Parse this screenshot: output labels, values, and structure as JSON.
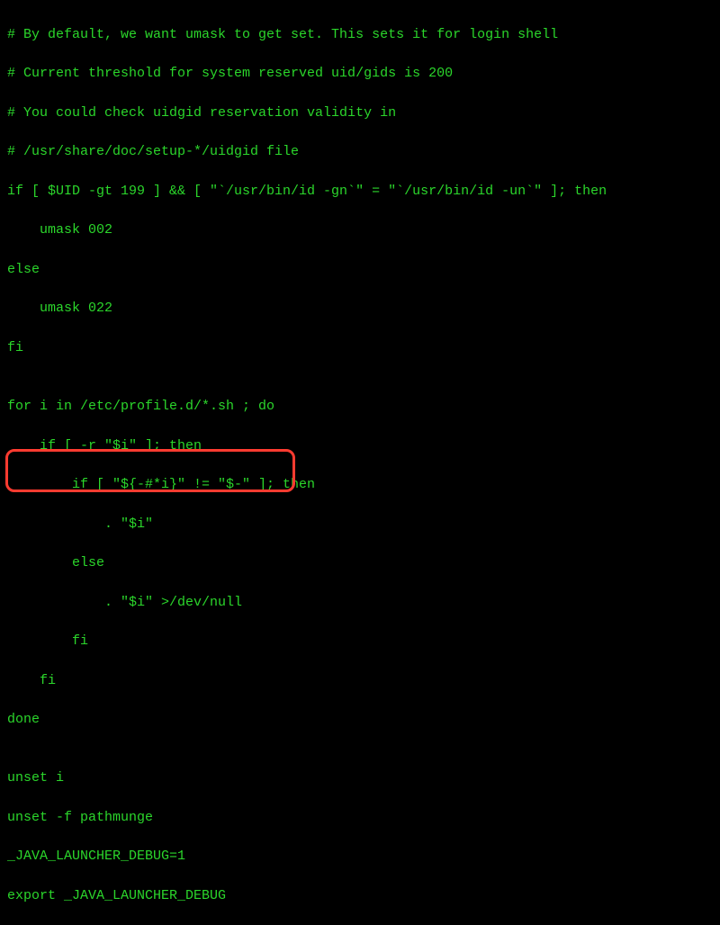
{
  "terminal": {
    "lines": [
      "# By default, we want umask to get set. This sets it for login shell",
      "# Current threshold for system reserved uid/gids is 200",
      "# You could check uidgid reservation validity in",
      "# /usr/share/doc/setup-*/uidgid file",
      "if [ $UID -gt 199 ] && [ \"`/usr/bin/id -gn`\" = \"`/usr/bin/id -un`\" ]; then",
      "    umask 002",
      "else",
      "    umask 022",
      "fi",
      "",
      "for i in /etc/profile.d/*.sh ; do",
      "    if [ -r \"$i\" ]; then",
      "        if [ \"${-#*i}\" != \"$-\" ]; then",
      "            . \"$i\"",
      "        else",
      "            . \"$i\" >/dev/null",
      "        fi",
      "    fi",
      "done",
      "",
      "unset i",
      "unset -f pathmunge",
      "_JAVA_LAUNCHER_DEBUG=1",
      "export _JAVA_LAUNCHER_DEBUG"
    ]
  },
  "annotation": {
    "highlight_start_line": 22,
    "highlight_end_line": 23,
    "highlight_color": "#ff3b30"
  }
}
